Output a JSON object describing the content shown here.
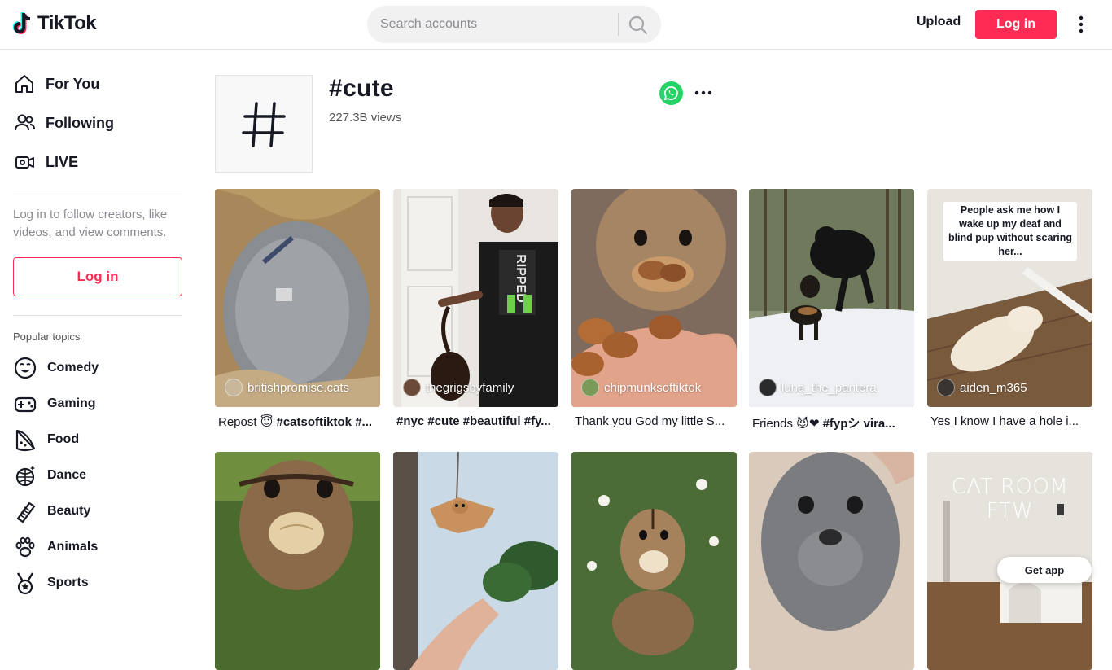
{
  "header": {
    "logo_text": "TikTok",
    "search_placeholder": "Search accounts",
    "upload_label": "Upload",
    "login_label": "Log in"
  },
  "sidebar": {
    "nav": [
      {
        "label": "For You",
        "icon": "home-icon"
      },
      {
        "label": "Following",
        "icon": "people-icon"
      },
      {
        "label": "LIVE",
        "icon": "live-icon"
      }
    ],
    "login_prompt": "Log in to follow creators, like videos, and view comments.",
    "login_label": "Log in",
    "popular_title": "Popular topics",
    "topics": [
      {
        "label": "Comedy",
        "icon": "smile-icon"
      },
      {
        "label": "Gaming",
        "icon": "gamepad-icon"
      },
      {
        "label": "Food",
        "icon": "pizza-icon"
      },
      {
        "label": "Dance",
        "icon": "disco-ball-icon"
      },
      {
        "label": "Beauty",
        "icon": "comb-icon"
      },
      {
        "label": "Animals",
        "icon": "paw-icon"
      },
      {
        "label": "Sports",
        "icon": "medal-icon"
      }
    ]
  },
  "hashtag": {
    "title": "#cute",
    "views": "227.3B views"
  },
  "videos": [
    {
      "author": "britishpromise.cats",
      "caption_plain": "Repost 😇 ",
      "caption_bold": "#catsoftiktok #..."
    },
    {
      "author": "thegrigsbyfamily",
      "caption_plain": "",
      "caption_bold": "#nyc #cute #beautiful #fy..."
    },
    {
      "author": "chipmunksoftiktok",
      "caption_plain": "Thank you God my little S...",
      "caption_bold": ""
    },
    {
      "author": "luna_the_pantera",
      "caption_plain": "Friends 😈❤ ",
      "caption_bold": "#fypシ   vira..."
    },
    {
      "author": "aiden_m365",
      "caption_plain": "Yes I know I have a hole i...",
      "caption_bold": "",
      "overlay": "People ask me how I wake up my deaf and blind pup without scaring her..."
    },
    {
      "author": "",
      "caption_plain": "",
      "caption_bold": ""
    },
    {
      "author": "",
      "caption_plain": "",
      "caption_bold": ""
    },
    {
      "author": "",
      "caption_plain": "",
      "caption_bold": ""
    },
    {
      "author": "",
      "caption_plain": "",
      "caption_bold": ""
    },
    {
      "author": "",
      "caption_plain": "",
      "caption_bold": "",
      "overlay": "CAT ROOM FTW"
    }
  ],
  "get_app_label": "Get app",
  "colors": {
    "brand": "#fe2c55",
    "whatsapp": "#25d366"
  }
}
